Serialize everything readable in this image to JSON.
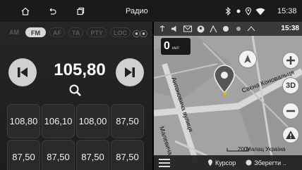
{
  "system_bar": {
    "title": "Радио",
    "time": "15:38",
    "icons": [
      "home-icon",
      "back-icon",
      "recent-apps-icon",
      "bluetooth-icon",
      "location-icon",
      "wifi-icon"
    ]
  },
  "radio": {
    "bands": [
      "AM",
      "FM",
      "AF",
      "TA",
      "PTY",
      "LOC"
    ],
    "active_band": "FM",
    "stereo": "⦿⦿",
    "frequency": "105,80",
    "presets": [
      "108,80",
      "106,10",
      "108,00",
      "87,50",
      "87,50",
      "87,50",
      "87,50",
      "87,50"
    ]
  },
  "navigation": {
    "status_time": "15:38",
    "speed": "0",
    "speed_unit": "км/г",
    "streets": [
      "Свєна Коновальця",
      "Антоновича вулиця",
      "Малевича"
    ],
    "scale": "200",
    "region": "Малац Україна",
    "cursor_label": "Курсор",
    "save_label": "Зберегти ..",
    "button_3d": "3D",
    "accent": "#e8e8e8"
  }
}
